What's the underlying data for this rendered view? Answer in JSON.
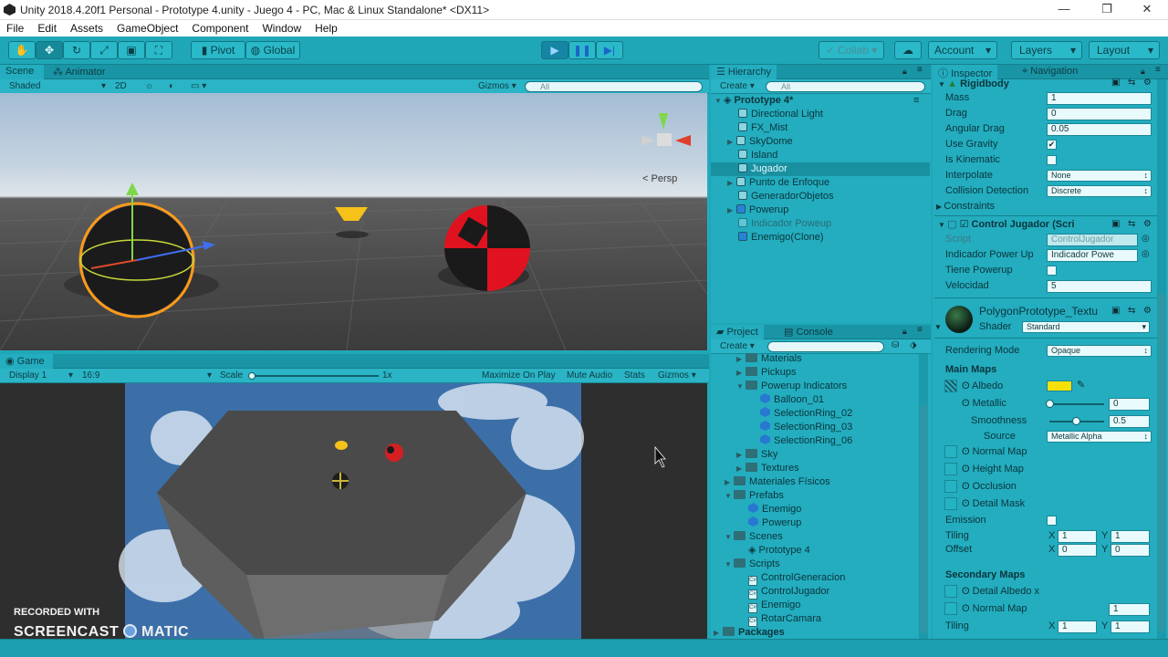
{
  "window": {
    "title": "Unity 2018.4.20f1 Personal - Prototype 4.unity - Juego 4 - PC, Mac & Linux Standalone* <DX11>",
    "controls": [
      "—",
      "❐",
      "✕"
    ]
  },
  "menu": [
    "File",
    "Edit",
    "Assets",
    "GameObject",
    "Component",
    "Window",
    "Help"
  ],
  "toolbar": {
    "pivot": "Pivot",
    "global": "Global",
    "collab": "Collab ▾",
    "account": "Account",
    "layers": "Layers",
    "layout": "Layout"
  },
  "scene": {
    "tabs": [
      "Scene",
      "Animator"
    ],
    "shading": "Shaded",
    "mode_2d": "2D",
    "gizmos": "Gizmos",
    "search_placeholder": "All",
    "persp": "Persp"
  },
  "game": {
    "tab": "Game",
    "display": "Display 1",
    "aspect": "16:9",
    "scale_label": "Scale",
    "scale_value": "1x",
    "maximize": "Maximize On Play",
    "mute": "Mute Audio",
    "stats": "Stats",
    "gizmos": "Gizmos"
  },
  "watermark": {
    "line1": "RECORDED WITH",
    "line2_a": "SCREENCAST",
    "line2_b": "MATIC"
  },
  "hierarchy": {
    "tab": "Hierarchy",
    "create": "Create",
    "search_placeholder": "All",
    "scene_name": "Prototype 4*",
    "items": [
      {
        "label": "Directional Light"
      },
      {
        "label": "FX_Mist"
      },
      {
        "label": "SkyDome"
      },
      {
        "label": "Island"
      },
      {
        "label": "Jugador"
      },
      {
        "label": "Punto de Enfoque"
      },
      {
        "label": "GeneradorObjetos"
      },
      {
        "label": "Powerup"
      },
      {
        "label": "Indicador Poweup"
      },
      {
        "label": "Enemigo(Clone)"
      }
    ]
  },
  "project": {
    "tabs": [
      "Project",
      "Console"
    ],
    "create": "Create",
    "items": [
      {
        "label": "Materials"
      },
      {
        "label": "Pickups"
      },
      {
        "label": "Powerup Indicators"
      },
      {
        "label": "Balloon_01"
      },
      {
        "label": "SelectionRing_02"
      },
      {
        "label": "SelectionRing_03"
      },
      {
        "label": "SelectionRing_06"
      },
      {
        "label": "Sky"
      },
      {
        "label": "Textures"
      },
      {
        "label": "Materiales Físicos"
      },
      {
        "label": "Prefabs"
      },
      {
        "label": "Enemigo"
      },
      {
        "label": "Powerup"
      },
      {
        "label": "Scenes"
      },
      {
        "label": "Prototype 4"
      },
      {
        "label": "Scripts"
      },
      {
        "label": "ControlGeneracion"
      },
      {
        "label": "ControlJugador"
      },
      {
        "label": "Enemigo"
      },
      {
        "label": "RotarCamara"
      },
      {
        "label": "Packages"
      }
    ]
  },
  "inspector": {
    "tabs": [
      "Inspector",
      "Navigation"
    ],
    "rigidbody": {
      "title": "Rigidbody",
      "mass_label": "Mass",
      "mass": "1",
      "drag_label": "Drag",
      "drag": "0",
      "angular_drag_label": "Angular Drag",
      "angular_drag": "0.05",
      "use_gravity_label": "Use Gravity",
      "is_kinematic_label": "Is Kinematic",
      "interpolate_label": "Interpolate",
      "interpolate": "None",
      "collision_label": "Collision Detection",
      "collision": "Discrete",
      "constraints_label": "Constraints"
    },
    "control_jugador": {
      "title": "Control Jugador (Scri",
      "script_label": "Script",
      "script": "ControlJugador",
      "indicador_label": "Indicador Power Up",
      "indicador": "Indicador Powe",
      "tiene_label": "Tiene Powerup",
      "velocidad_label": "Velocidad",
      "velocidad": "5"
    },
    "material": {
      "name": "PolygonPrototype_Textu",
      "shader_label": "Shader",
      "shader": "Standard",
      "rendering_label": "Rendering Mode",
      "rendering": "Opaque",
      "main_maps": "Main Maps",
      "albedo": "Albedo",
      "metallic": "Metallic",
      "metallic_value": "0",
      "smoothness": "Smoothness",
      "smoothness_value": "0.5",
      "source": "Source",
      "source_value": "Metallic Alpha",
      "normal_map": "Normal Map",
      "height_map": "Height Map",
      "occlusion": "Occlusion",
      "detail_mask": "Detail Mask",
      "emission": "Emission",
      "tiling": "Tiling",
      "offset": "Offset",
      "x": "X",
      "y": "Y",
      "tiling_x": "1",
      "tiling_y": "1",
      "offset_x": "0",
      "offset_y": "0",
      "secondary_maps": "Secondary Maps",
      "detail_albedo": "Detail Albedo x",
      "normal_map2": "Normal Map",
      "normal_map2_value": "1",
      "tiling2": "Tiling",
      "tiling2_x": "1",
      "tiling2_y": "1"
    }
  },
  "colors": {
    "accent": "#1fa7b8",
    "selection": "#1990a0",
    "albedo": "#f5e10a"
  }
}
